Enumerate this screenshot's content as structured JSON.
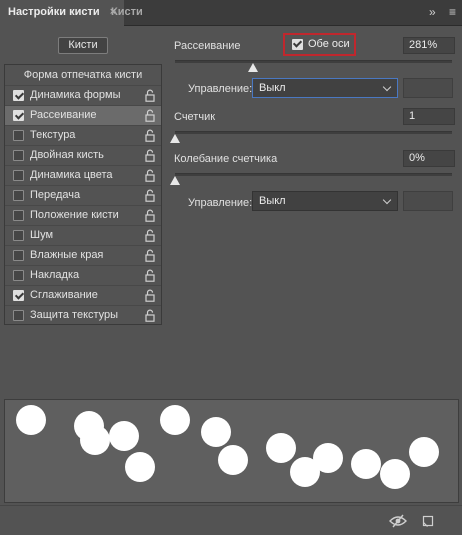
{
  "tabs": [
    {
      "label": "Настройки кисти",
      "close": "×",
      "active": true
    },
    {
      "label": "Кисти",
      "active": false
    }
  ],
  "panel_icons": {
    "expand": "»",
    "menu": "≡"
  },
  "left": {
    "presets_button": "Кисти",
    "tip_shape_label": "Форма отпечатка кисти",
    "items": [
      {
        "label": "Динамика формы",
        "checked": true,
        "selected": false
      },
      {
        "label": "Рассеивание",
        "checked": true,
        "selected": true
      },
      {
        "label": "Текстура",
        "checked": false,
        "selected": false
      },
      {
        "label": "Двойная кисть",
        "checked": false,
        "selected": false
      },
      {
        "label": "Динамика цвета",
        "checked": false,
        "selected": false
      },
      {
        "label": "Передача",
        "checked": false,
        "selected": false
      },
      {
        "label": "Положение кисти",
        "checked": false,
        "selected": false
      },
      {
        "label": "Шум",
        "checked": false,
        "selected": false
      },
      {
        "label": "Влажные края",
        "checked": false,
        "selected": false
      },
      {
        "label": "Накладка",
        "checked": false,
        "selected": false
      },
      {
        "label": "Сглаживание",
        "checked": true,
        "selected": false
      },
      {
        "label": "Защита текстуры",
        "checked": false,
        "selected": false
      }
    ]
  },
  "right": {
    "scatter": {
      "label": "Рассеивание",
      "both_axes_label": "Обе оси",
      "both_axes_checked": true,
      "value": "281%",
      "slider_fraction": 0.281
    },
    "control1": {
      "label": "Управление:",
      "value": "Выкл"
    },
    "count": {
      "label": "Счетчик",
      "value": "1",
      "slider_fraction": 0.0
    },
    "count_jitter": {
      "label": "Колебание счетчика",
      "value": "0%",
      "slider_fraction": 0.0
    },
    "control2": {
      "label": "Управление:",
      "value": "Выкл"
    }
  },
  "preview": {
    "dot_count": 14,
    "dot_color": "#ffffff"
  },
  "colors": {
    "panel": "#535353",
    "highlight": "#c0272d",
    "focus": "#4a78c2"
  }
}
